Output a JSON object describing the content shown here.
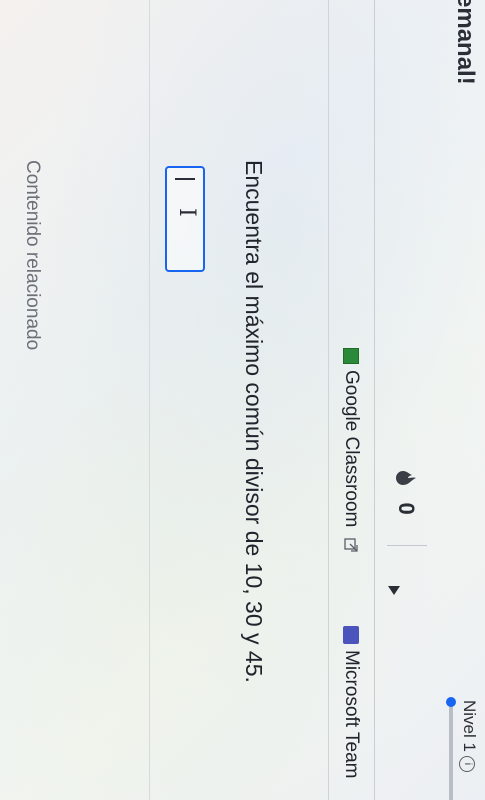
{
  "header": {
    "partial_title": "emanal!",
    "streak_count": "0",
    "level_label": "Nivel 1",
    "info_glyph": "i",
    "progress": 0.0
  },
  "share": {
    "google_classroom_label": "Google Classroom",
    "microsoft_teams_label": "Microsoft Team"
  },
  "exercise": {
    "question": "Encuentra el máximo común divisor de 10, 30 y 45.",
    "answer_value": ""
  },
  "footer": {
    "related_label": "Contenido relacionado"
  },
  "colors": {
    "accent": "#1865f2",
    "text": "#21242c",
    "muted": "#6b6f78",
    "classroom_green": "#2a8a3a",
    "teams_purple": "#4b53bc"
  },
  "icons": {
    "streak": "flame-icon",
    "info": "info-icon",
    "play": "play-icon",
    "external": "external-link-icon",
    "cursor": "text-cursor-icon"
  }
}
